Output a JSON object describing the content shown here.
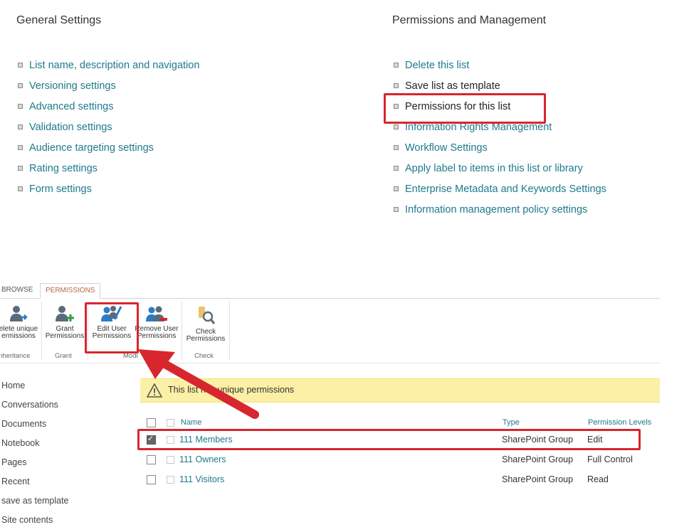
{
  "general_settings": {
    "heading": "General Settings",
    "links": [
      "List name, description and navigation",
      "Versioning settings",
      "Advanced settings",
      "Validation settings",
      "Audience targeting settings",
      "Rating settings",
      "Form settings"
    ]
  },
  "permissions_management": {
    "heading": "Permissions and Management",
    "links": [
      "Delete this list",
      "Save list as template",
      "Permissions for this list",
      "Information Rights Management",
      "Workflow Settings",
      "Apply label to items in this list or library",
      "Enterprise Metadata and Keywords Settings",
      "Information management policy settings"
    ]
  },
  "ribbon": {
    "tabs": [
      "BROWSE",
      "PERMISSIONS"
    ],
    "buttons": {
      "delete_unique": [
        "elete unique",
        "ermissions"
      ],
      "grant": [
        "Grant",
        "Permissions"
      ],
      "edit_user": [
        "Edit User",
        "Permissions"
      ],
      "remove_user": [
        "Remove User",
        "Permissions"
      ],
      "check": [
        "Check",
        "Permissions"
      ]
    },
    "groups": {
      "inheritance": "nheritance",
      "grant": "Grant",
      "modify": "Modi",
      "check": "Check"
    }
  },
  "left_nav": [
    "Home",
    "Conversations",
    "Documents",
    "Notebook",
    "Pages",
    "Recent",
    "save as template",
    "Site contents"
  ],
  "banner": {
    "text": "This list has unique permissions"
  },
  "table": {
    "headers": {
      "name": "Name",
      "type": "Type",
      "permission": "Permission Levels"
    },
    "rows": [
      {
        "name": "111 Members",
        "type": "SharePoint Group",
        "permission": "Edit",
        "checked": true
      },
      {
        "name": "111 Owners",
        "type": "SharePoint Group",
        "permission": "Full Control",
        "checked": false
      },
      {
        "name": "111 Visitors",
        "type": "SharePoint Group",
        "permission": "Read",
        "checked": false
      }
    ]
  },
  "colors": {
    "link": "#1e7a8c",
    "highlight": "#d7262e",
    "banner": "#fcf0a6",
    "active_tab": "#b5683a"
  }
}
